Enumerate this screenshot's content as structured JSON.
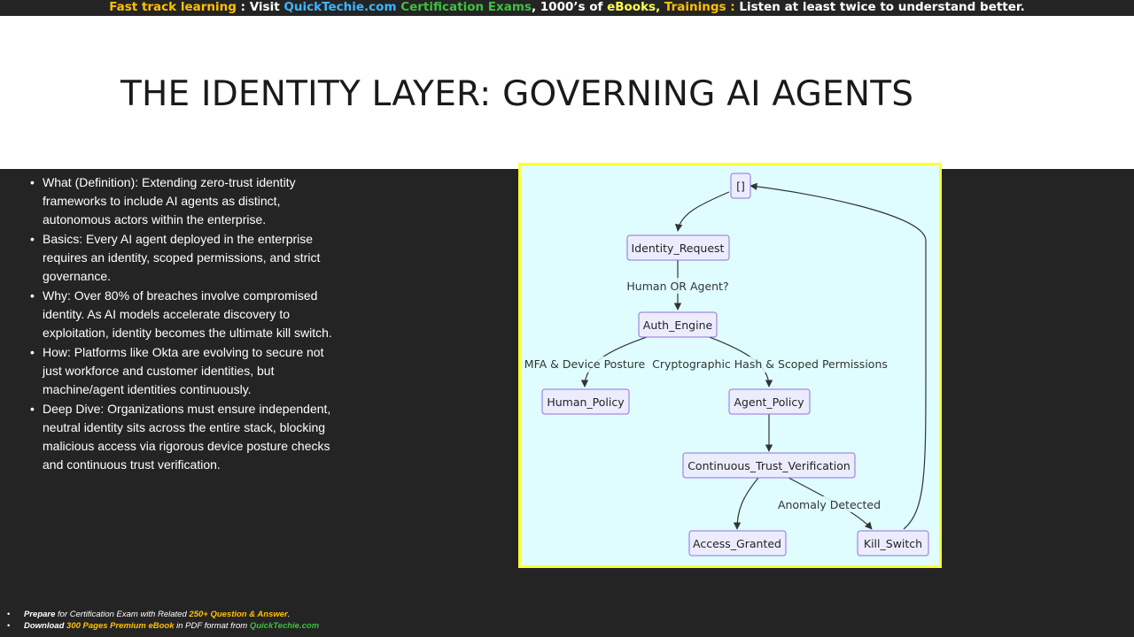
{
  "banner": {
    "part1": "Fast track learning",
    "part2": " : Visit ",
    "part3": "QuickTechie.com",
    "part4": "  Certification Exams",
    "part5": ", 1000’s of ",
    "part6": "eBooks,",
    "part7": " Trainings : ",
    "part8": "Listen at least twice to understand better."
  },
  "slide": {
    "title": "THE IDENTITY LAYER: GOVERNING AI AGENTS"
  },
  "bullets": [
    "What (Definition): Extending zero-trust identity frameworks to include AI agents as distinct, autonomous actors within the enterprise.",
    "Basics: Every AI agent deployed in the enterprise requires an identity, scoped permissions, and strict governance.",
    "Why: Over 80% of breaches involve compromised identity. As AI models accelerate discovery to exploitation, identity becomes the ultimate kill switch.",
    "How: Platforms like Okta are evolving to secure not just workforce and customer identities, but machine/agent identities continuously.",
    "Deep Dive: Organizations must ensure independent, neutral identity sits across the entire stack, blocking malicious access via rigorous device posture checks and continuous trust verification."
  ],
  "diagram": {
    "nodes": {
      "start": "[]",
      "identity_request": "Identity_Request",
      "auth_engine": "Auth_Engine",
      "human_policy": "Human_Policy",
      "agent_policy": "Agent_Policy",
      "ctv": "Continuous_Trust_Verification",
      "access_granted": "Access_Granted",
      "kill_switch": "Kill_Switch"
    },
    "edge_labels": {
      "human_or_agent": "Human OR Agent?",
      "mfa": "MFA & Device Posture",
      "crypto": "Cryptographic Hash & Scoped Permissions",
      "anomaly": "Anomaly Detected"
    },
    "colors": {
      "background": "#dffdff",
      "border": "#ffff33",
      "node_fill": "#ececff",
      "node_stroke": "#9370db"
    }
  },
  "footer": {
    "line1": {
      "prepare": "Prepare",
      "text1": " for Certification Exam with  Related ",
      "highlight": "250+ Question & Answer",
      "text2": "."
    },
    "line2": {
      "download": "Download",
      "highlight": " 300 Pages Premium eBook",
      "text1": " in PDF format from ",
      "site": "QuickTechie.com"
    }
  }
}
